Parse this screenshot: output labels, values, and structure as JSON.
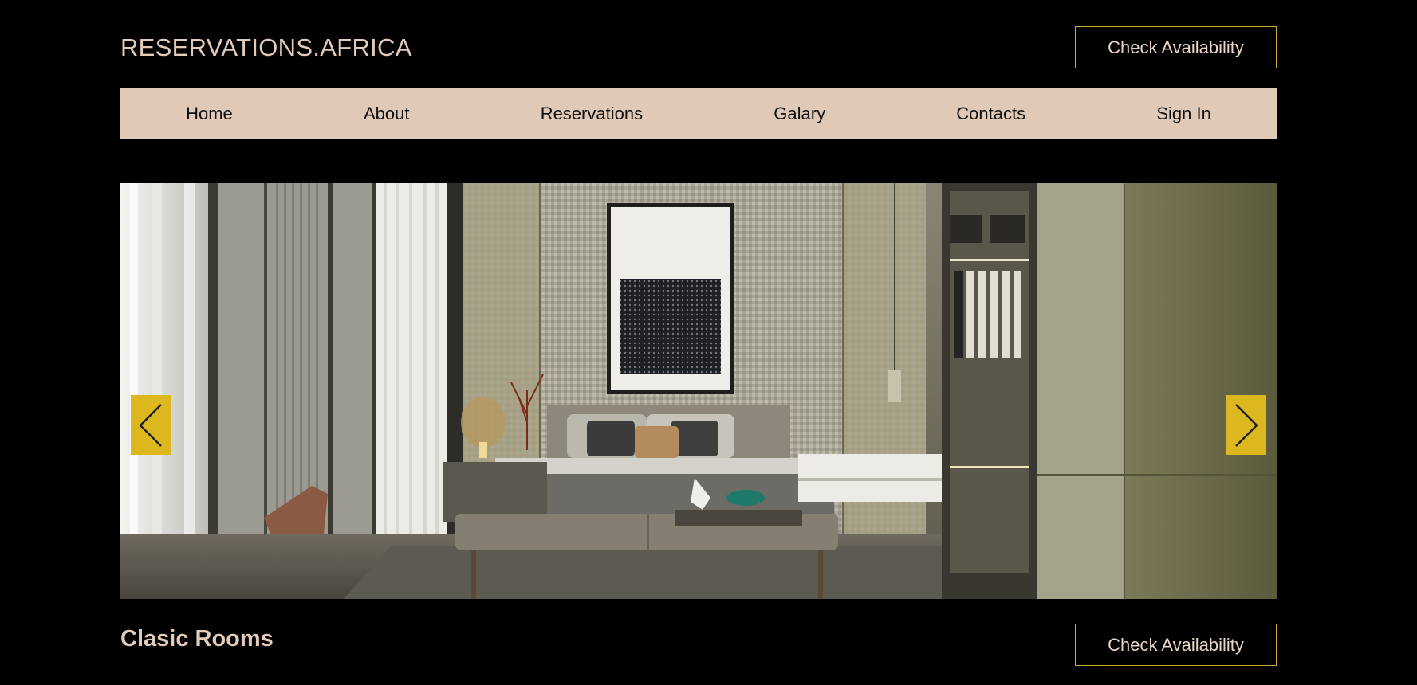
{
  "brand": {
    "name": "RESERVATIONS.AFRICA"
  },
  "header": {
    "cta_label": "Check Availability"
  },
  "nav": {
    "items": [
      {
        "label": "Home"
      },
      {
        "label": "About"
      },
      {
        "label": "Reservations"
      },
      {
        "label": "Galary"
      },
      {
        "label": "Contacts"
      },
      {
        "label": "Sign In"
      }
    ]
  },
  "slider": {
    "image_subject": "bedroom-interior",
    "prev_icon": "chevron-left-icon",
    "next_icon": "chevron-right-icon"
  },
  "room_section": {
    "title": "Clasic Rooms",
    "cta_label": "Check Availability"
  },
  "colors": {
    "background": "#000000",
    "accent": "#dcb81e",
    "nav_bg": "#e0c9b7",
    "text_beige": "#e2cbb8",
    "button_border": "#c9a92c"
  }
}
